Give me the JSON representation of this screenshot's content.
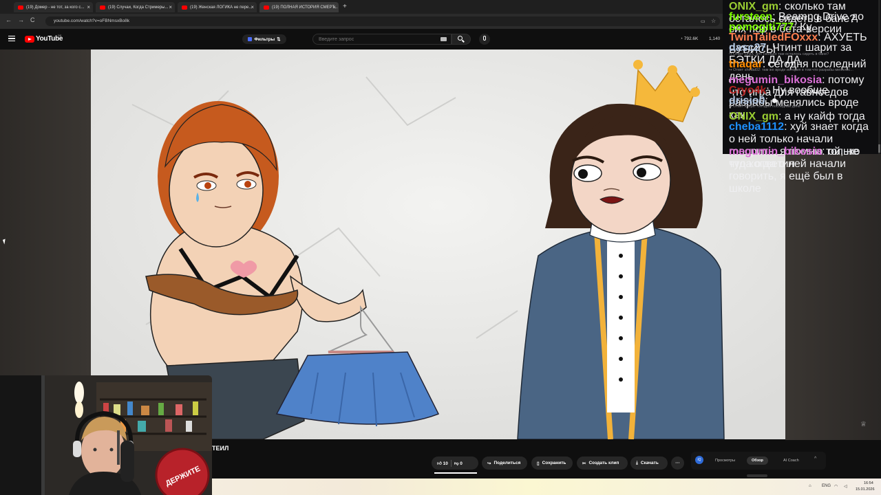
{
  "browser": {
    "tabs": [
      {
        "label": "(19) Домер - не тот, за кого с..."
      },
      {
        "label": "(19) Случаи, Когда Стримеры..."
      },
      {
        "label": "(19) Женская ЛОГИКА не пере..."
      },
      {
        "label": "(19) ПОЛНАЯ ИСТОРИЯ СМЕРТ..."
      }
    ],
    "new_tab": "+",
    "url": "youtube.com/watch?v=oFBNmsxBo8k",
    "nav": {
      "back": "←",
      "forward": "→",
      "reload": "C"
    }
  },
  "youtube": {
    "logo_text": "YouTube",
    "region": "DE",
    "filter_label": "Фильтры",
    "search_placeholder": "Введите запрос",
    "stats": {
      "views": "792.6K",
      "second": "1,140"
    }
  },
  "video": {
    "title_fragment": "ТЕИЛ",
    "actions": {
      "likes": "10",
      "dislikes": "0",
      "share": "Поделиться",
      "save": "Сохранить",
      "clip": "Создать клип",
      "download": "Скачать",
      "more": "···"
    }
  },
  "ai_panel": {
    "logo": "iQ",
    "tabs": [
      "Просмотры",
      "Обзор",
      "AI Coach"
    ],
    "active_tab": "Обзор",
    "chevron": "^"
  },
  "taskbar": {
    "lang": "ENG",
    "time": "16:54",
    "date": "15.01.2026"
  },
  "webcam": {
    "sign_text": "ДЕРЖИТЕ"
  },
  "chat": {
    "colors": {
      "onix": "#9acd32",
      "fursteen": "#7cfc00",
      "pomogiti": "#7cfc00",
      "twin": "#ff7f50",
      "dasc": "#b0c4de",
      "thaqar": "#ff8c00",
      "megumin": "#da70d6",
      "cryo": "#b22222",
      "drisio": "#b0c4de",
      "cheba": "#1e90ff"
    },
    "messages": [
      {
        "user": "ONIX_gm",
        "text": "сколько там осталось сидеть в бане?"
      },
      {
        "user": "fursteen",
        "text": "Beamng Drive до сих пор в бета-версии"
      },
      {
        "user": "pomogiti777",
        "text": "Ку"
      },
      {
        "user": "TwinTailedFOxxx",
        "text": "АХУЕТЬ БУБИСЫ"
      },
      {
        "user": "dasc27",
        "text": "Чтинт шарит за БЭТКИ ДА ДА"
      },
      {
        "reply": "Ответ ONIX_gm: сколько там осталось сидеть в бане?"
      },
      {
        "user": "thaqar",
        "text": "сегодня последний день"
      },
      {
        "reply": "Ответ shedal02: там же вроде история в том что разрабы менялис..."
      },
      {
        "user": "megumin_bikosia",
        "text": "потому что игра для гавноедов"
      },
      {
        "user": "Cryo4k",
        "text": "Ну вообще разрабы менялись вроде как"
      },
      {
        "user": "drisio0",
        "text": ""
      },
      {
        "reply": "Ответ thaqar: сегодня последний день"
      },
      {
        "user": "ONIX_gm",
        "text": "а ну кайф тогда"
      },
      {
        "user": "cheba1112",
        "text": "хуй знает когда о ней только начали говорить, я помню только что когда о ней начали говорить, я ещё был в школе"
      },
      {
        "user": "megumin_bikosia",
        "text": "ой, не туда ответил"
      }
    ]
  }
}
